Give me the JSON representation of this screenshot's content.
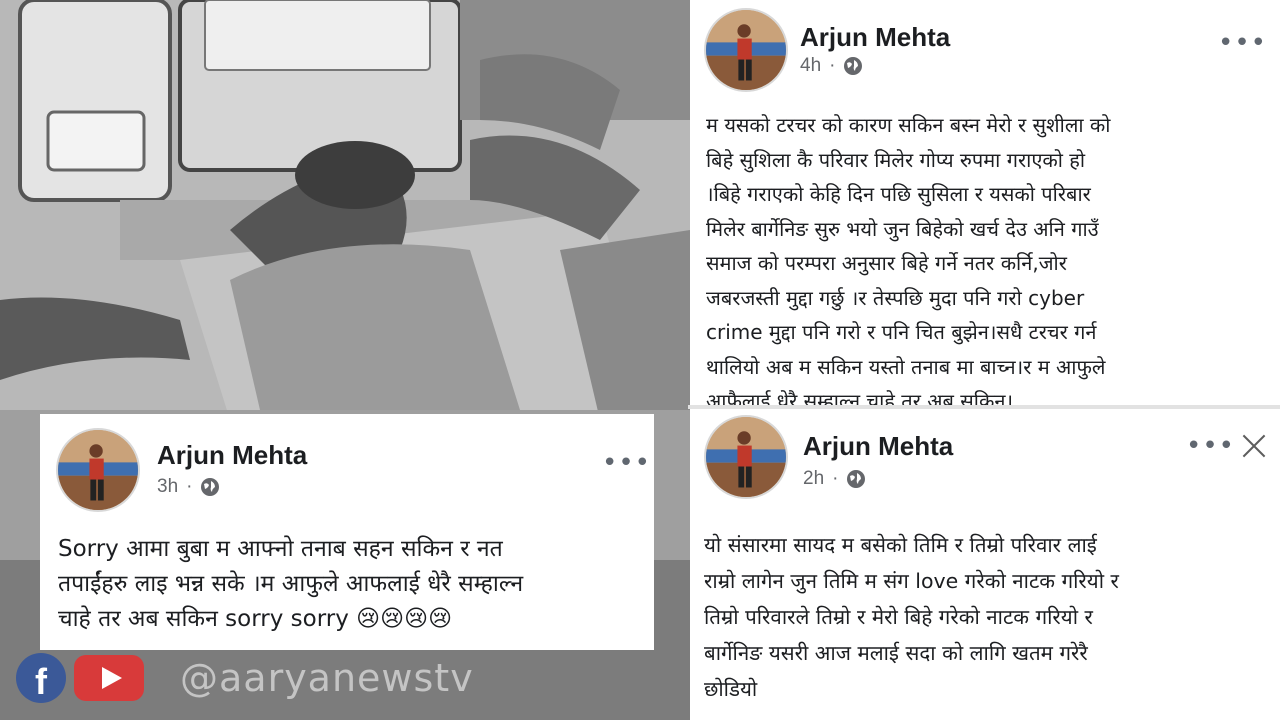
{
  "post_top_right": {
    "author": "Arjun Mehta",
    "time": "4h",
    "privacy_icon": "globe-icon",
    "more_icon": "more-options-icon",
    "body": "म यसको टरचर को कारण सकिन बस्न मेरो र सुशीला को\nबिहे सुशिला कै परिवार मिलेर गोप्य रुपमा गराएको हो\n।बिहे गराएको केहि दिन पछि सुसिला र यसको परिबार\nमिलेर बार्गेनिङ सुरु भयो जुन बिहेको खर्च देउ अनि गाउँ\nसमाज को परम्परा अनुसार बिहे गर्ने नतर कर्नि,जोर\nजबरजस्ती मुद्दा गर्छु ।र तेस्पछि मुदा पनि गरो cyber\ncrime मुद्दा पनि गरो र पनि चित बुझेन।सधै टरचर गर्न\nथालियो अब म सकिन यस्तो तनाब मा बाच्न।र म आफुले\nआफैलाई धेरै सम्हाल्न चाहे तर अब सकिन।"
  },
  "post_bottom_right": {
    "author": "Arjun Mehta",
    "time": "2h",
    "privacy_icon": "globe-icon",
    "more_icon": "more-options-icon",
    "close_icon": "close-icon",
    "body": "यो संसारमा सायद म बसेको तिमि र तिम्रो परिवार लाई\nराम्रो लागेन जुन तिमि म संग love गरेको नाटक गरियो र\nतिम्रो परिवारले तिम्रो र मेरो बिहे गरेको नाटक गरियो र\nबार्गेनिङ यसरी आज मलाई सदा को लागि खतम गरेरै\nछोडियो"
  },
  "post_left": {
    "author": "Arjun Mehta",
    "time": "3h",
    "privacy_icon": "globe-icon",
    "more_icon": "more-options-icon",
    "body": "Sorry आमा बुबा म आफ्नो तनाब सहन सकिन र नत\nतपाईंहरु लाइ भन्न सके ।म आफुले आफलाई धेरै सम्हाल्न\nचाहे तर अब सकिन sorry sorry 😢😢😢😢"
  },
  "watermark": {
    "facebook_icon": "facebook-icon",
    "youtube_icon": "youtube-icon",
    "handle": "@aaryanewstv"
  },
  "colors": {
    "author": "#1c1e21",
    "meta": "#65676b",
    "facebook": "#3b5998",
    "youtube": "#d83a3a"
  }
}
